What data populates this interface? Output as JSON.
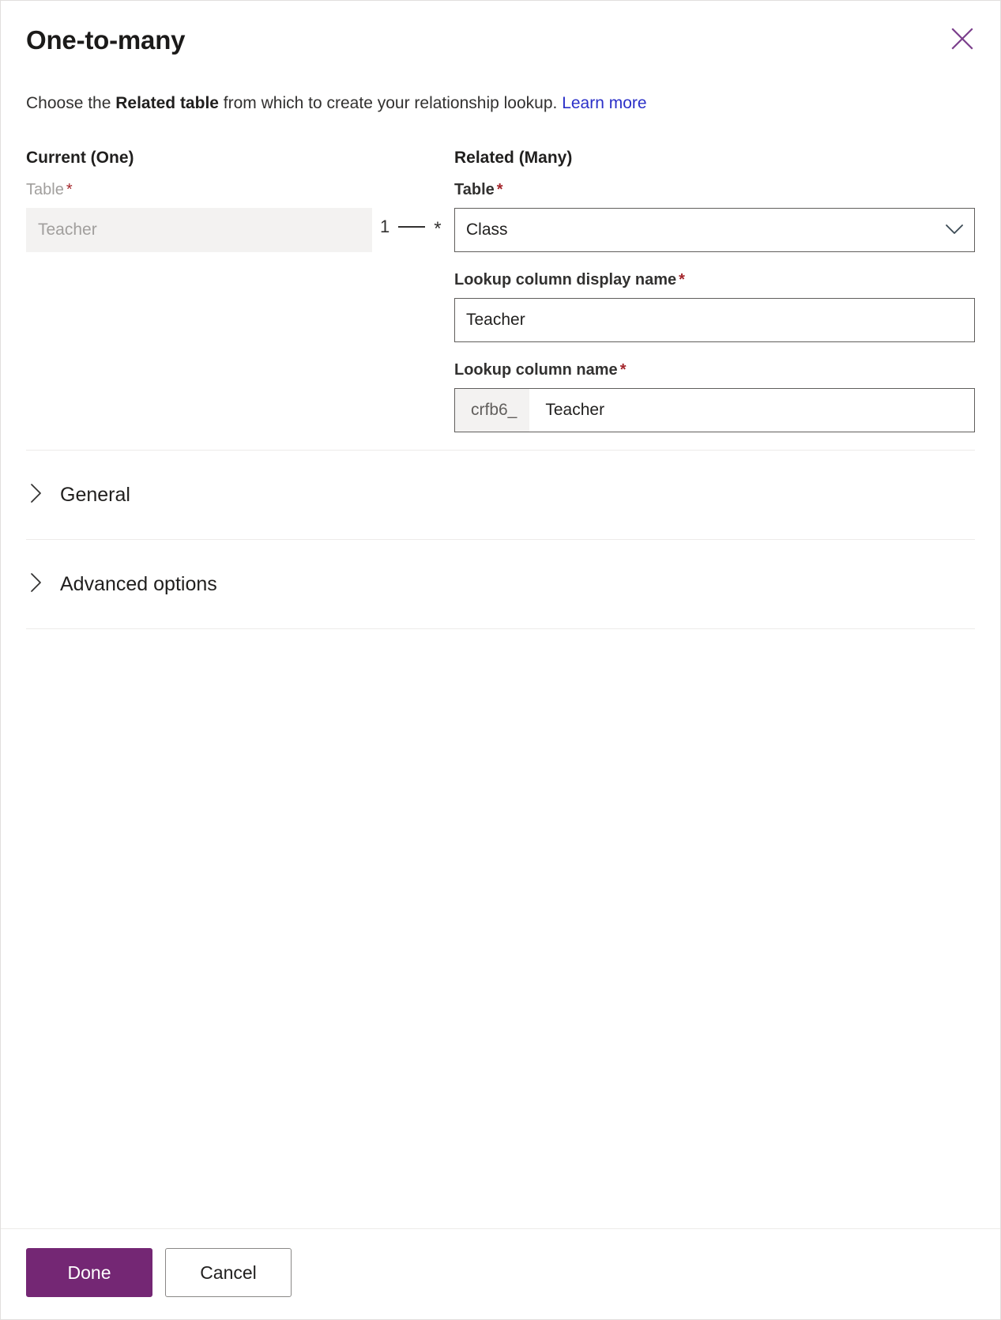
{
  "dialog": {
    "title": "One-to-many",
    "close_icon": "close-icon",
    "subtitle": {
      "before": "Choose the ",
      "strong": "Related table",
      "after": " from which to create your relationship lookup. ",
      "link": "Learn more"
    }
  },
  "current": {
    "heading": "Current (One)",
    "table_label": "Table",
    "required_mark": "*",
    "table_value": "Teacher"
  },
  "cardinality": {
    "one": "1",
    "many": "*"
  },
  "related": {
    "heading": "Related (Many)",
    "table_label": "Table",
    "table_value": "Class",
    "chevron_icon": "chevron-down-icon",
    "display_name_label": "Lookup column display name",
    "display_name_value": "Teacher",
    "column_name_label": "Lookup column name",
    "column_name_prefix": "crfb6_",
    "column_name_value": "Teacher",
    "required_mark": "*"
  },
  "sections": [
    {
      "label": "General",
      "icon": "chevron-right-icon"
    },
    {
      "label": "Advanced options",
      "icon": "chevron-right-icon"
    }
  ],
  "footer": {
    "done_label": "Done",
    "cancel_label": "Cancel"
  },
  "colors": {
    "primary": "#742774",
    "link": "#2b30c8",
    "required": "#a4262c",
    "field_border": "#605e5c",
    "disabled_bg": "#f3f2f1",
    "divider": "#edebe9"
  }
}
